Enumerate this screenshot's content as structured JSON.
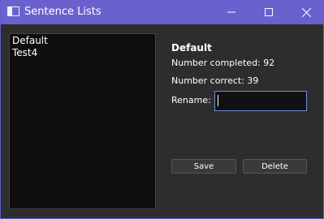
{
  "window": {
    "title": "Sentence Lists"
  },
  "titlebar_buttons": {
    "minimize_icon": "minimize-icon",
    "maximize_icon": "maximize-icon",
    "close_icon": "close-icon"
  },
  "list": {
    "items": [
      "Default",
      "Test4"
    ]
  },
  "details": {
    "name": "Default",
    "completed_label": "Number completed: 92",
    "correct_label": "Number correct: 39",
    "rename_label": "Rename:",
    "rename_value": ""
  },
  "buttons": {
    "save": "Save",
    "delete": "Delete"
  },
  "colors": {
    "titlebar": "#6a61cf",
    "background": "#2d2d2d",
    "list_background": "#0e0e0e",
    "input_focus_border": "#6a8fd6"
  }
}
